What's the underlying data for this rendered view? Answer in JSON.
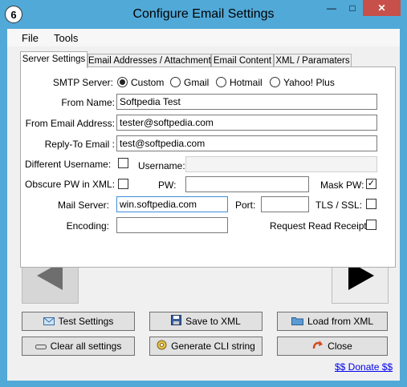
{
  "window": {
    "title": "Configure Email Settings",
    "minimize_glyph": "—",
    "maximize_glyph": "□",
    "close_glyph": "✕",
    "app_icon_glyph": "6"
  },
  "menu": {
    "file": "File",
    "tools": "Tools"
  },
  "tabs": [
    {
      "label": "Server Settings",
      "active": true
    },
    {
      "label": "Email Addresses / Attachment",
      "active": false
    },
    {
      "label": "Email Content",
      "active": false
    },
    {
      "label": "XML / Paramaters",
      "active": false
    }
  ],
  "server": {
    "smtp_label": "SMTP Server:",
    "smtp_options": [
      {
        "label": "Custom",
        "selected": true
      },
      {
        "label": "Gmail",
        "selected": false
      },
      {
        "label": "Hotmail",
        "selected": false
      },
      {
        "label": "Yahoo! Plus",
        "selected": false
      }
    ],
    "from_name_label": "From Name:",
    "from_name_value": "Softpedia Test",
    "from_email_label": "From Email Address:",
    "from_email_value": "tester@softpedia.com",
    "reply_to_label": "Reply-To Email :",
    "reply_to_value": "test@softpedia.com",
    "diff_username_label": "Different Username:",
    "diff_username_checked": false,
    "username_label": "Username:",
    "username_value": "",
    "obscure_pw_label": "Obscure PW in XML:",
    "obscure_pw_checked": false,
    "pw_label": "PW:",
    "pw_value": "",
    "mask_pw_label": "Mask PW:",
    "mask_pw_checked": true,
    "mail_server_label": "Mail Server:",
    "mail_server_value": "win.softpedia.com",
    "port_label": "Port:",
    "port_value": "",
    "tls_label": "TLS / SSL:",
    "tls_checked": false,
    "encoding_label": "Encoding:",
    "encoding_value": "",
    "read_receipt_label": "Request Read Receipt:",
    "read_receipt_checked": false
  },
  "buttons": {
    "test": "Test Settings",
    "save_xml": "Save to XML",
    "load_xml": "Load from XML",
    "clear": "Clear all settings",
    "cli": "Generate CLI string",
    "close": "Close"
  },
  "donate": "$$ Donate $$",
  "icons": {
    "app": "app-icon",
    "prev": "left-arrow-icon",
    "next": "right-arrow-icon",
    "test": "envelope-icon",
    "save": "save-icon",
    "load": "folder-icon",
    "clear": "eraser-icon",
    "cli": "gear-icon",
    "close": "close-arrow-icon"
  },
  "colors": {
    "titlebar": "#51a9d8",
    "close_button": "#c7504a",
    "link": "#0000ee"
  }
}
